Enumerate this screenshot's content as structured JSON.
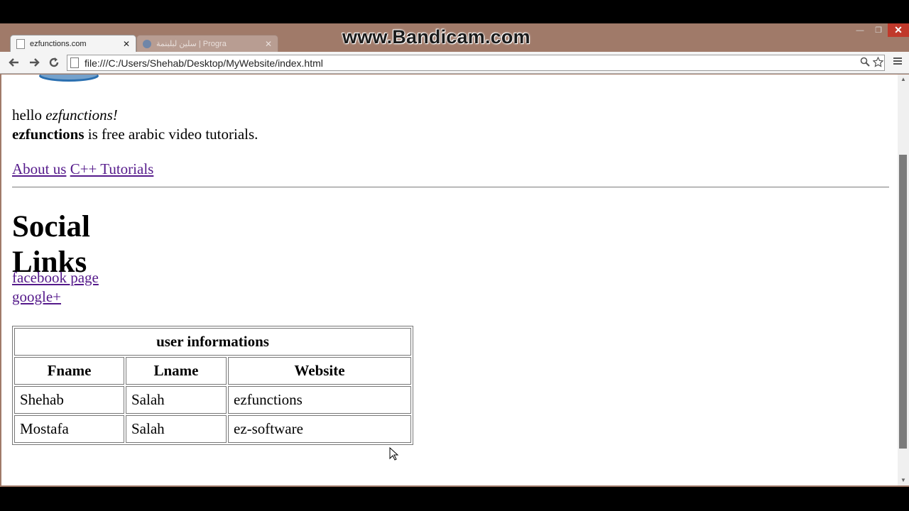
{
  "browser": {
    "watermark": "www.Bandicam.com",
    "active_tab": {
      "title": "ezfunctions.com",
      "close": "✕"
    },
    "inactive_tab": {
      "title": "سلين لبلبنمة | Progra",
      "close": "✕"
    },
    "window_controls": {
      "minimize": "—",
      "maximize": "❐",
      "close": "✕"
    },
    "address": "file:///C:/Users/Shehab/Desktop/MyWebsite/index.html",
    "icons": {
      "back": "back-arrow-icon",
      "forward": "forward-arrow-icon",
      "reload": "reload-icon",
      "zoom": "magnifier-icon",
      "bookmark": "star-icon",
      "menu": "hamburger-menu-icon"
    }
  },
  "page": {
    "greeting_prefix": "hello ",
    "greeting_name": "ezfunctions!",
    "site_name": "ezfunctions",
    "tagline": " is free arabic video tutorials.",
    "nav_links": [
      "About us",
      "C++ Tutorials"
    ],
    "social_heading": "Social Links",
    "social_links": [
      "facebook page",
      "google+"
    ],
    "table": {
      "caption": "user informations",
      "headers": [
        "Fname",
        "Lname",
        "Website"
      ],
      "rows": [
        [
          "Shehab",
          "Salah",
          "ezfunctions"
        ],
        [
          "Mostafa",
          "Salah",
          "ez-software"
        ]
      ]
    }
  },
  "colors": {
    "visited_link": "#551a8b",
    "frame": "#a07a69"
  }
}
